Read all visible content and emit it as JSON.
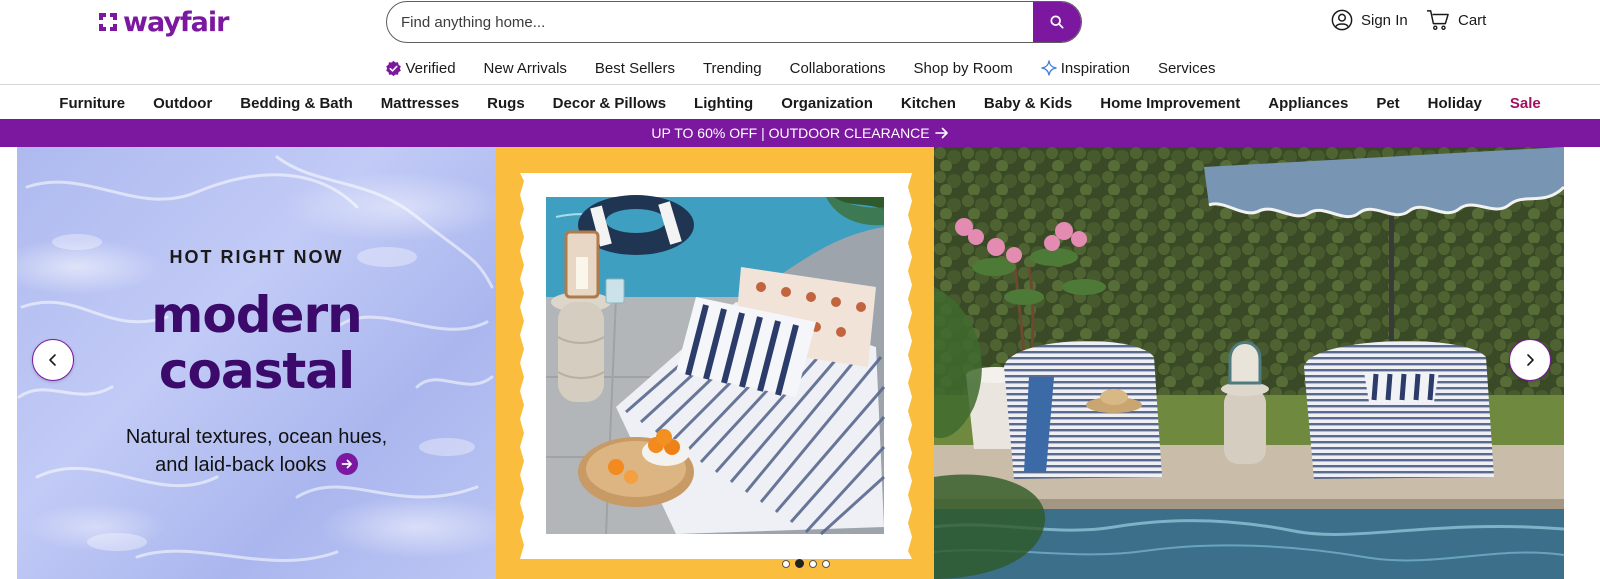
{
  "brand": {
    "logo_text": "wayfair",
    "accent_color": "#7b189f",
    "sale_color": "#a3105f"
  },
  "search": {
    "placeholder": "Find anything home...",
    "icon": "search-icon"
  },
  "account": {
    "label": "Sign In",
    "icon": "user-circle-icon"
  },
  "cart": {
    "label": "Cart",
    "icon": "cart-icon"
  },
  "subnav": [
    {
      "label": "Verified",
      "icon": "verified-badge-icon"
    },
    {
      "label": "New Arrivals"
    },
    {
      "label": "Best Sellers"
    },
    {
      "label": "Trending"
    },
    {
      "label": "Collaborations"
    },
    {
      "label": "Shop by Room"
    },
    {
      "label": "Inspiration",
      "icon": "sparkle-icon"
    },
    {
      "label": "Services"
    }
  ],
  "categories": [
    "Furniture",
    "Outdoor",
    "Bedding & Bath",
    "Mattresses",
    "Rugs",
    "Decor & Pillows",
    "Lighting",
    "Organization",
    "Kitchen",
    "Baby & Kids",
    "Home Improvement",
    "Appliances",
    "Pet",
    "Holiday",
    "Sale"
  ],
  "promo": {
    "text": "UP TO 60% OFF | OUTDOOR CLEARANCE",
    "icon": "arrow-right-icon"
  },
  "hero": {
    "eyebrow": "HOT RIGHT NOW",
    "headline_line1": "modern",
    "headline_line2": "coastal",
    "sub_line1": "Natural textures, ocean hues,",
    "sub_line2": "and laid-back looks",
    "slides_count": 4,
    "active_slide": 2,
    "prev_icon": "chevron-left-icon",
    "next_icon": "chevron-right-icon"
  }
}
